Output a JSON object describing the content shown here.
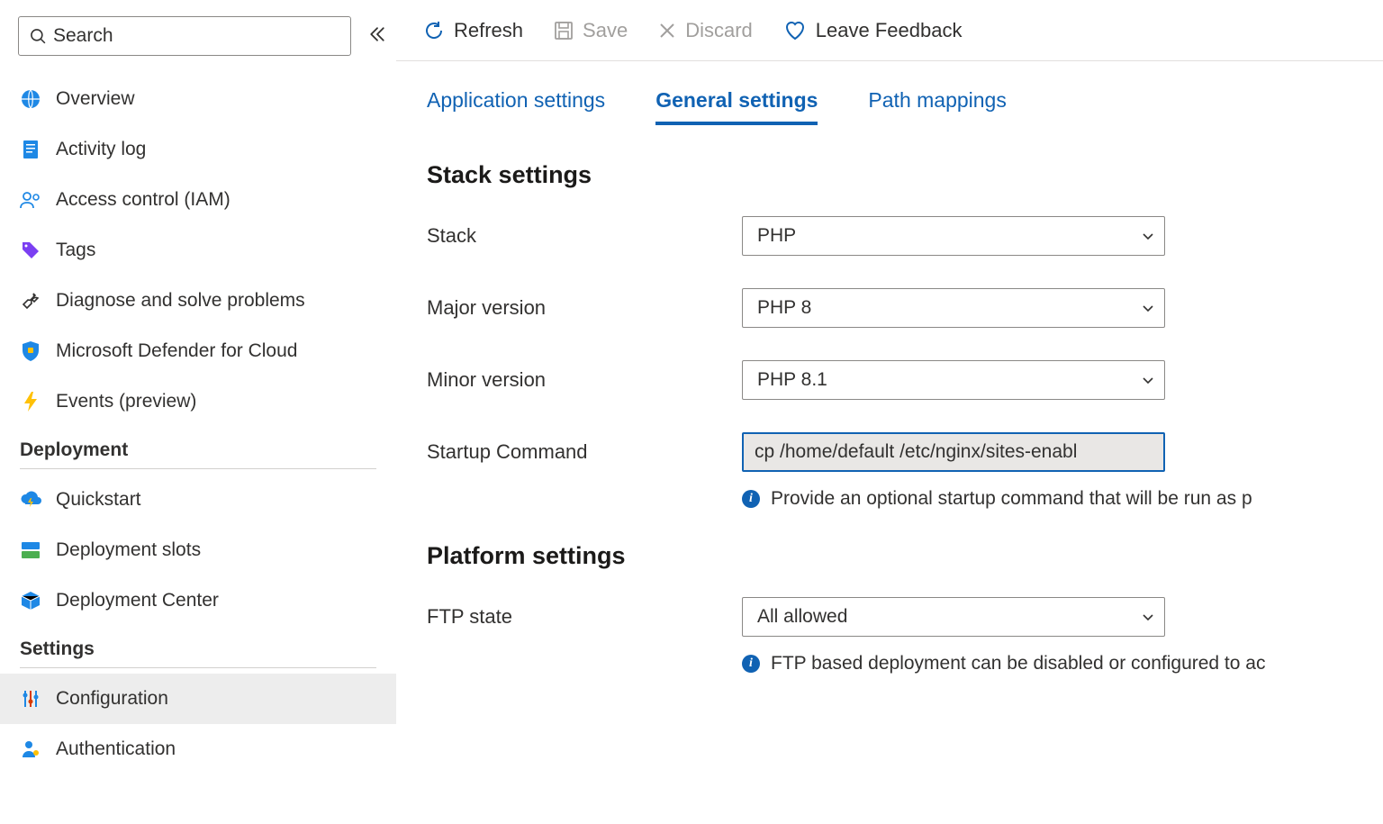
{
  "sidebar": {
    "search_placeholder": "Search",
    "items": [
      {
        "label": "Overview"
      },
      {
        "label": "Activity log"
      },
      {
        "label": "Access control (IAM)"
      },
      {
        "label": "Tags"
      },
      {
        "label": "Diagnose and solve problems"
      },
      {
        "label": "Microsoft Defender for Cloud"
      },
      {
        "label": "Events (preview)"
      }
    ],
    "section_deployment": "Deployment",
    "deployment_items": [
      {
        "label": "Quickstart"
      },
      {
        "label": "Deployment slots"
      },
      {
        "label": "Deployment Center"
      }
    ],
    "section_settings": "Settings",
    "settings_items": [
      {
        "label": "Configuration"
      },
      {
        "label": "Authentication"
      }
    ]
  },
  "toolbar": {
    "refresh": "Refresh",
    "save": "Save",
    "discard": "Discard",
    "feedback": "Leave Feedback"
  },
  "tabs": {
    "app_settings": "Application settings",
    "general_settings": "General settings",
    "path_mappings": "Path mappings"
  },
  "content": {
    "stack_heading": "Stack settings",
    "stack_label": "Stack",
    "stack_value": "PHP",
    "major_label": "Major version",
    "major_value": "PHP 8",
    "minor_label": "Minor version",
    "minor_value": "PHP 8.1",
    "startup_label": "Startup Command",
    "startup_value": "cp /home/default /etc/nginx/sites-enabl",
    "startup_info": "Provide an optional startup command that will be run as p",
    "platform_heading": "Platform settings",
    "ftp_label": "FTP state",
    "ftp_value": "All allowed",
    "ftp_info": "FTP based deployment can be disabled or configured to ac"
  }
}
